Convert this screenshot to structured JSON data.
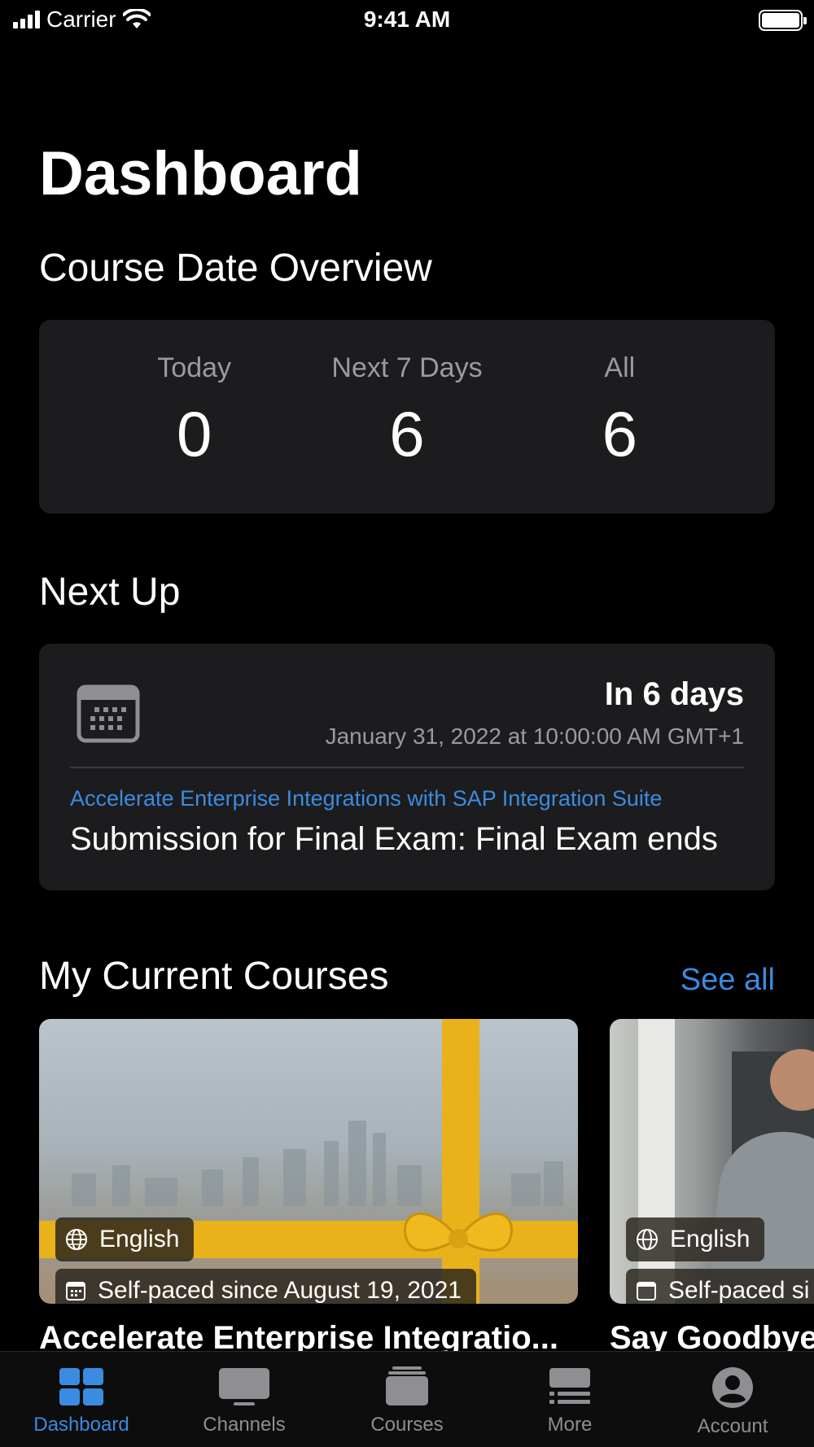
{
  "status_bar": {
    "carrier": "Carrier",
    "time": "9:41 AM"
  },
  "page": {
    "title": "Dashboard"
  },
  "course_date_overview": {
    "title": "Course Date Overview",
    "columns": [
      {
        "label": "Today",
        "value": "0"
      },
      {
        "label": "Next 7 Days",
        "value": "6"
      },
      {
        "label": "All",
        "value": "6"
      }
    ]
  },
  "next_up": {
    "title": "Next Up",
    "relative": "In 6 days",
    "date": "January 31, 2022 at 10:00:00 AM GMT+1",
    "course": "Accelerate Enterprise Integrations with SAP Integration Suite",
    "item": "Submission for Final Exam: Final Exam ends"
  },
  "current_courses": {
    "title": "My Current Courses",
    "see_all": "See all",
    "courses": [
      {
        "language": "English",
        "date_tag": "Self-paced since August 19, 2021",
        "title": "Accelerate Enterprise Integratio..."
      },
      {
        "language": "English",
        "date_tag": "Self-paced si",
        "title": "Say Goodbye"
      }
    ]
  },
  "tab_bar": {
    "active": "Dashboard",
    "tabs": [
      {
        "label": "Dashboard",
        "icon": "dashboard-grid-icon"
      },
      {
        "label": "Channels",
        "icon": "tv-icon"
      },
      {
        "label": "Courses",
        "icon": "stack-icon"
      },
      {
        "label": "More",
        "icon": "list-icon"
      },
      {
        "label": "Account",
        "icon": "person-circle-icon"
      }
    ]
  },
  "colors": {
    "accent": "#3b8be0",
    "card": "#1c1c1e",
    "background": "#000000",
    "ribbon": "#e9b21b"
  }
}
